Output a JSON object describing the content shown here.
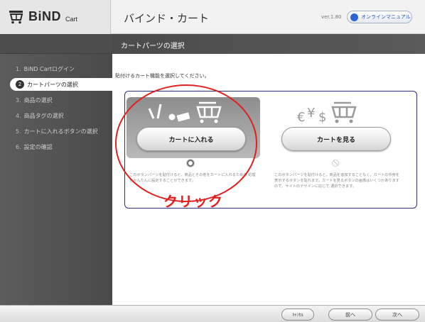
{
  "header": {
    "logo_text": "BiND",
    "logo_sub": "Cart",
    "title": "バインド・カート",
    "version": "ver.1.80",
    "manual_label": "オンラインマニュアル"
  },
  "sidebar": {
    "steps": [
      {
        "num": "1.",
        "label": "BiND Cartログイン"
      },
      {
        "num": "2",
        "label": "カートパーツの選択"
      },
      {
        "num": "3.",
        "label": "商品の選択"
      },
      {
        "num": "4.",
        "label": "商品タグの選択"
      },
      {
        "num": "5.",
        "label": "カートに入れるボタンの選択"
      },
      {
        "num": "6.",
        "label": "設定の確認"
      }
    ]
  },
  "main": {
    "title": "カートパーツの選択",
    "instruction": "貼付けるカート機能を選択してください。",
    "options": [
      {
        "button_label": "カートに入れる",
        "description": "このボタンパーツを貼付けると、商品とその他をカートに入れるための 処理をかんたんに設定することができます。"
      },
      {
        "button_label": "カートを見る",
        "description": "このボタンパーツを貼付けると、商品を追加することなく、カートの中身を 表示するボタンを貼れます。カートを見るボタンの画像はいくつかありますので、サイトのデザインに応じて 選択できます。"
      }
    ],
    "annotation": "クリック"
  },
  "footer": {
    "cancel_label": "ｷｬﾝｾﾙ",
    "back_label": "前へ",
    "next_label": "次へ"
  },
  "colors": {
    "accent_blue": "#2a66d8",
    "annotation_red": "#e02020",
    "frame_navy": "#2f2f77"
  }
}
